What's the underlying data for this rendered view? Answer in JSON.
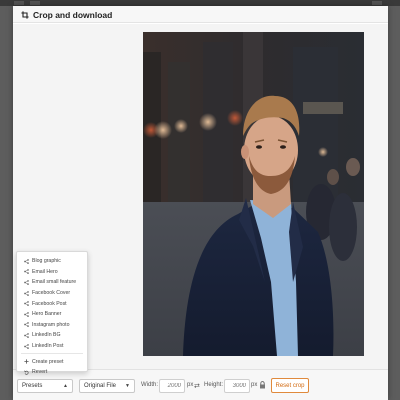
{
  "modal": {
    "title": "Crop and download"
  },
  "toolbar": {
    "presets_value": "Presets",
    "file_value": "Original File",
    "width_label": "Width:",
    "width_placeholder": "2000",
    "width_unit": "px",
    "height_label": "Height:",
    "height_placeholder": "3000",
    "height_unit": "px",
    "reset_label": "Reset crop"
  },
  "presets_menu": {
    "items": [
      {
        "label": "Blog graphic",
        "icon": "share-icon"
      },
      {
        "label": "Email Hero",
        "icon": "share-icon"
      },
      {
        "label": "Email small feature",
        "icon": "share-icon"
      },
      {
        "label": "Facebook Cover",
        "icon": "share-icon"
      },
      {
        "label": "Facebook Post",
        "icon": "share-icon"
      },
      {
        "label": "Hero Banner",
        "icon": "share-icon"
      },
      {
        "label": "Instagram photo",
        "icon": "share-icon"
      },
      {
        "label": "LinkedIn BG",
        "icon": "share-icon"
      },
      {
        "label": "LinkedIn Post",
        "icon": "share-icon"
      }
    ],
    "actions": [
      {
        "label": "Create preset",
        "icon": "plus-icon"
      },
      {
        "label": "Revert",
        "icon": "undo-icon"
      }
    ]
  },
  "colors": {
    "accent": "#d26a10",
    "overlay": "#6f6f6f"
  }
}
